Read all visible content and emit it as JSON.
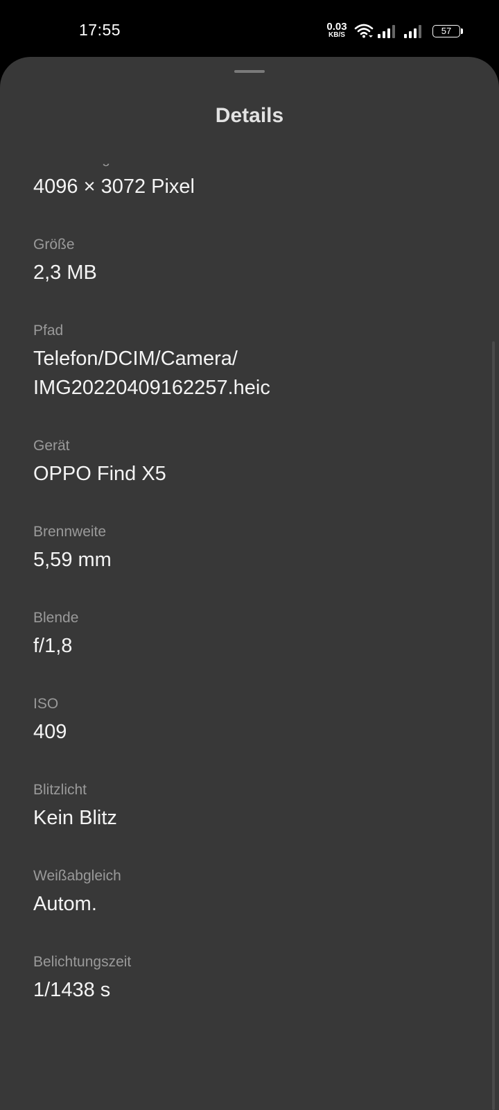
{
  "status_bar": {
    "time": "17:55",
    "net_speed_value": "0.03",
    "net_speed_unit": "KB/S",
    "battery_level": "57",
    "icons": [
      "wifi-icon",
      "signal-icon",
      "signal-icon",
      "battery-icon"
    ]
  },
  "sheet": {
    "title": "Details",
    "items": [
      {
        "label": "Abmessungen",
        "value": "4096 × 3072 Pixel"
      },
      {
        "label": "Größe",
        "value": "2,3 MB"
      },
      {
        "label": "Pfad",
        "value": "Telefon/DCIM/Camera/\nIMG20220409162257.heic"
      },
      {
        "label": "Gerät",
        "value": "OPPO Find X5"
      },
      {
        "label": "Brennweite",
        "value": "5,59 mm"
      },
      {
        "label": "Blende",
        "value": "f/1,8"
      },
      {
        "label": "ISO",
        "value": "409"
      },
      {
        "label": "Blitzlicht",
        "value": "Kein Blitz"
      },
      {
        "label": "Weißabgleich",
        "value": "Autom."
      },
      {
        "label": "Belichtungszeit",
        "value": "1/1438 s"
      }
    ]
  },
  "colors": {
    "background": "#000000",
    "sheet": "#383838",
    "label": "#9a9a9a",
    "value": "#f4f4f4",
    "title": "#e2e2e2"
  }
}
